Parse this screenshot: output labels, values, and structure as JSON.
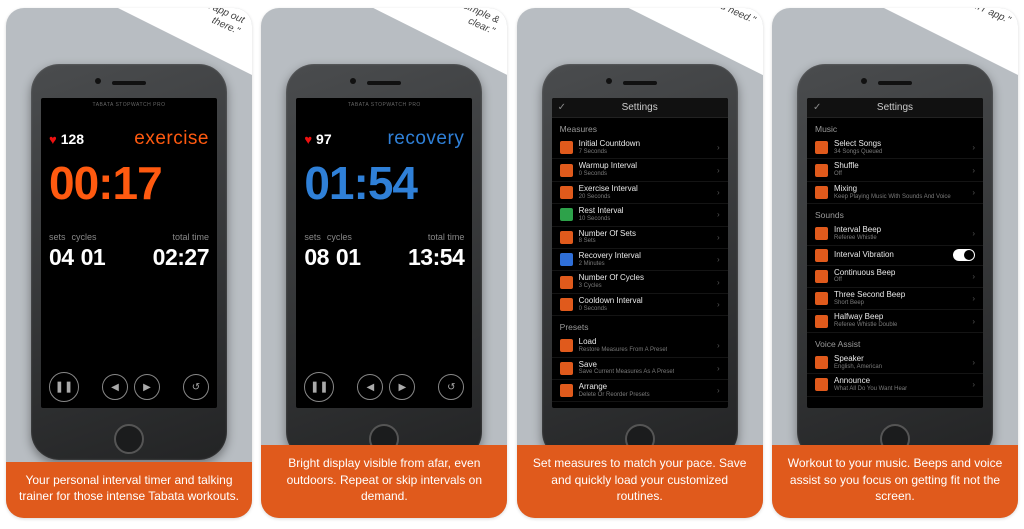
{
  "panels": [
    {
      "quote": "\"Best Tabata app out there.\"",
      "caption": "Your personal interval timer and talking trainer for those intense Tabata workouts."
    },
    {
      "quote": "\"Love. So nice, simple & clear.\"",
      "caption": "Bright display visible from afar, even outdoors. Repeat or skip intervals on demand."
    },
    {
      "quote": "\"Everything you need.\"",
      "caption": "Set measures to match your pace. Save and quickly load your customized routines."
    },
    {
      "quote": "\"Perfect, best HIIT app.\"",
      "caption": "Workout to your music. Beeps and voice assist so you focus on getting fit not the screen."
    }
  ],
  "timerA": {
    "app_title": "TABATA STOPWATCH PRO",
    "hr": "128",
    "mode": "exercise",
    "big_time": "00:17",
    "label_sets": "sets",
    "label_cycles": "cycles",
    "label_total": "total time",
    "sets": "04",
    "cycles": "01",
    "total": "02:27"
  },
  "timerB": {
    "app_title": "TABATA STOPWATCH PRO",
    "hr": "97",
    "mode": "recovery",
    "big_time": "01:54",
    "label_sets": "sets",
    "label_cycles": "cycles",
    "label_total": "total time",
    "sets": "08",
    "cycles": "01",
    "total": "13:54"
  },
  "settingsA": {
    "title": "Settings",
    "done_glyph": "✓",
    "section_measures": "Measures",
    "section_presets": "Presets",
    "measures": [
      {
        "label": "Initial Countdown",
        "sub": "7 Seconds",
        "color": "o"
      },
      {
        "label": "Warmup Interval",
        "sub": "0 Seconds",
        "color": "o"
      },
      {
        "label": "Exercise Interval",
        "sub": "20 Seconds",
        "color": "o"
      },
      {
        "label": "Rest Interval",
        "sub": "10 Seconds",
        "color": "g"
      },
      {
        "label": "Number Of Sets",
        "sub": "8 Sets",
        "color": "o"
      },
      {
        "label": "Recovery Interval",
        "sub": "2 Minutes",
        "color": "b"
      },
      {
        "label": "Number Of Cycles",
        "sub": "3 Cycles",
        "color": "o"
      },
      {
        "label": "Cooldown Interval",
        "sub": "0 Seconds",
        "color": "o"
      }
    ],
    "presets": [
      {
        "label": "Load",
        "sub": "Restore Measures From A Preset",
        "color": "o"
      },
      {
        "label": "Save",
        "sub": "Save Current Measures As A Preset",
        "color": "o"
      },
      {
        "label": "Arrange",
        "sub": "Delete Or Reorder Presets",
        "color": "o"
      }
    ]
  },
  "settingsB": {
    "title": "Settings",
    "done_glyph": "✓",
    "section_music": "Music",
    "section_sounds": "Sounds",
    "section_voice": "Voice Assist",
    "music": [
      {
        "label": "Select Songs",
        "sub": "34 Songs Queued",
        "color": "o"
      },
      {
        "label": "Shuffle",
        "sub": "Off",
        "color": "o"
      },
      {
        "label": "Mixing",
        "sub": "Keep Playing Music With Sounds And Voice",
        "color": "o"
      }
    ],
    "sounds": [
      {
        "label": "Interval Beep",
        "sub": "Referee Whistle",
        "color": "o"
      },
      {
        "label": "Interval Vibration",
        "sub": "",
        "color": "o",
        "toggle": true
      },
      {
        "label": "Continuous Beep",
        "sub": "Off",
        "color": "o"
      },
      {
        "label": "Three Second Beep",
        "sub": "Short Beep",
        "color": "o"
      },
      {
        "label": "Halfway Beep",
        "sub": "Referee Whistle Double",
        "color": "o"
      }
    ],
    "voice": [
      {
        "label": "Speaker",
        "sub": "English, American",
        "color": "o"
      },
      {
        "label": "Announce",
        "sub": "What All Do You Want Hear",
        "color": "o"
      }
    ]
  },
  "controls": {
    "pause": "❚❚",
    "prev": "◀",
    "next": "▶",
    "reset": "↺"
  }
}
